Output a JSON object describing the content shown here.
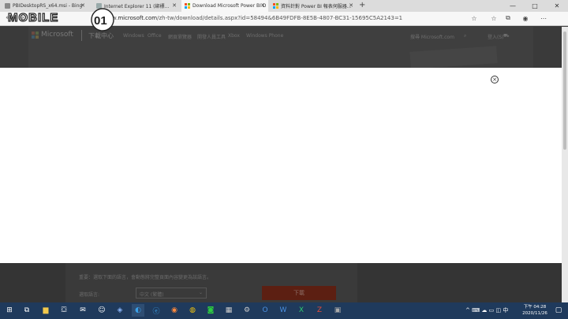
{
  "tabs": [
    {
      "label": "PBIDesktopRS_x64.msi - Bing",
      "active": false
    },
    {
      "label": "Internet Explorer 11 (綁標...",
      "active": false
    },
    {
      "label": "Download Microsoft Power BI D",
      "active": true
    },
    {
      "label": "資料針對 Power BI 報表伺服器...",
      "active": false
    }
  ],
  "new_tab": "+",
  "window_controls": {
    "minimize": "—",
    "maximize": "□",
    "close": "✕"
  },
  "url": {
    "prefix": "w.",
    "domain": "microsoft.com",
    "path": "/zh-tw/download/details.aspx?id=58494&6B49FDFB-8E5B-4807-BC31-15695C5A2143=1"
  },
  "page_header": {
    "brand": "Microsoft",
    "section": "下載中心",
    "nav": [
      "Windows",
      "Office",
      "網頁瀏覽器",
      "開發人員工具",
      "Xbox",
      "Windows Phone"
    ],
    "search_label": "搜尋 Microsoft.com",
    "account": "登入(S)"
  },
  "modal": {
    "close_glyph": "×"
  },
  "lower": {
    "note": "重要：選取下面的語言，會動態將完整頁面內容變更為該語言。",
    "language_label": "選取語言:",
    "language_value": "中文 (繁體)",
    "download_label": "下載"
  },
  "taskbar": {
    "icons": [
      "windows-start",
      "task-view",
      "file-explorer",
      "store",
      "mail",
      "edge-legacy",
      "ie",
      "edge",
      "firefox",
      "chrome",
      "line",
      "calculator",
      "settings",
      "outlook",
      "word",
      "excel",
      "filezilla",
      "media"
    ],
    "time": "下午 04:28",
    "date": "2020/11/26"
  },
  "watermark": "MOBILE01",
  "colors": {
    "ms_red": "#f25022",
    "ms_green": "#7fba00",
    "ms_blue": "#00a4ef",
    "ms_yellow": "#ffb900",
    "taskbar": "#1f3a5c"
  }
}
